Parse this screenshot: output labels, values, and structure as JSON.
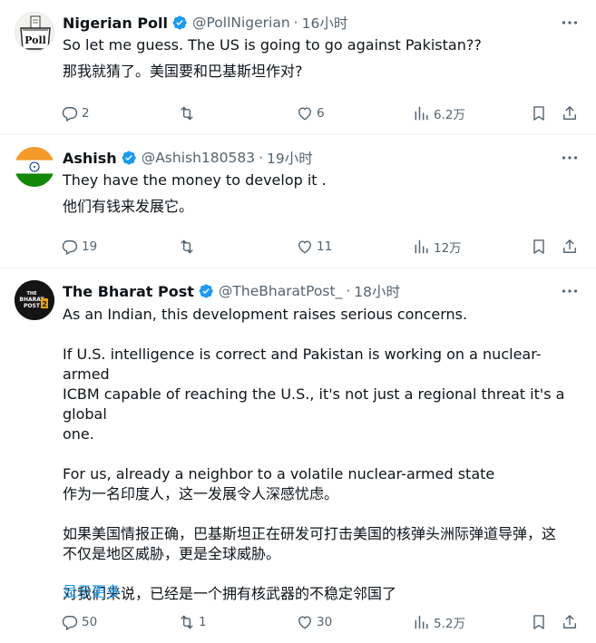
{
  "tweets": [
    {
      "name": "Nigerian Poll",
      "handle": "@PollNigerian",
      "dot": "·",
      "time": "16小时",
      "avatar_text": "Poll",
      "lines": [
        "So let me guess. The US is going to go against Pakistan??",
        "那我就猜了。美国要和巴基斯坦作对?"
      ],
      "replies": "2",
      "retweets": "",
      "likes": "6",
      "views": "6.2万"
    },
    {
      "name": "Ashish",
      "handle": "@Ashish180583",
      "dot": "·",
      "time": "19小时",
      "lines": [
        "They have the money to develop it .",
        "他们有钱来发展它。"
      ],
      "replies": "19",
      "retweets": "",
      "likes": "11",
      "views": "12万"
    },
    {
      "name": "The Bharat Post",
      "handle": "@TheBharatPost_",
      "dot": "·",
      "time": "18小时",
      "avatar_text": "THE BHARAT POST",
      "lines": [
        "As an Indian, this development raises serious concerns.",
        "",
        "If U.S. intelligence is correct and Pakistan is working on a nuclear-armed",
        "ICBM capable of reaching the U.S., it's not just a regional threat it's a global",
        "one.",
        "",
        "For us, already a neighbor to a volatile nuclear-armed state",
        "作为一名印度人，这一发展令人深感忧虑。",
        "",
        "如果美国情报正确，巴基斯坦正在研发可打击美国的核弹头洲际弹道导弹，这",
        "不仅是地区威胁，更是全球威胁。",
        "",
        "对我们来说，已经是一个拥有核武器的不稳定邻国了"
      ],
      "show_more": "显示更多",
      "replies": "50",
      "retweets": "1",
      "likes": "30",
      "views": "5.2万"
    }
  ],
  "icons": [
    "verified-badge-icon",
    "more-icon",
    "reply-icon",
    "retweet-icon",
    "like-icon",
    "views-icon",
    "bookmark-icon",
    "share-icon"
  ],
  "colors": {
    "text": "#0f1419",
    "secondary": "#536471",
    "link": "#1d9bf0",
    "verified": "#1d9bf0",
    "divider": "#eff3f4"
  }
}
